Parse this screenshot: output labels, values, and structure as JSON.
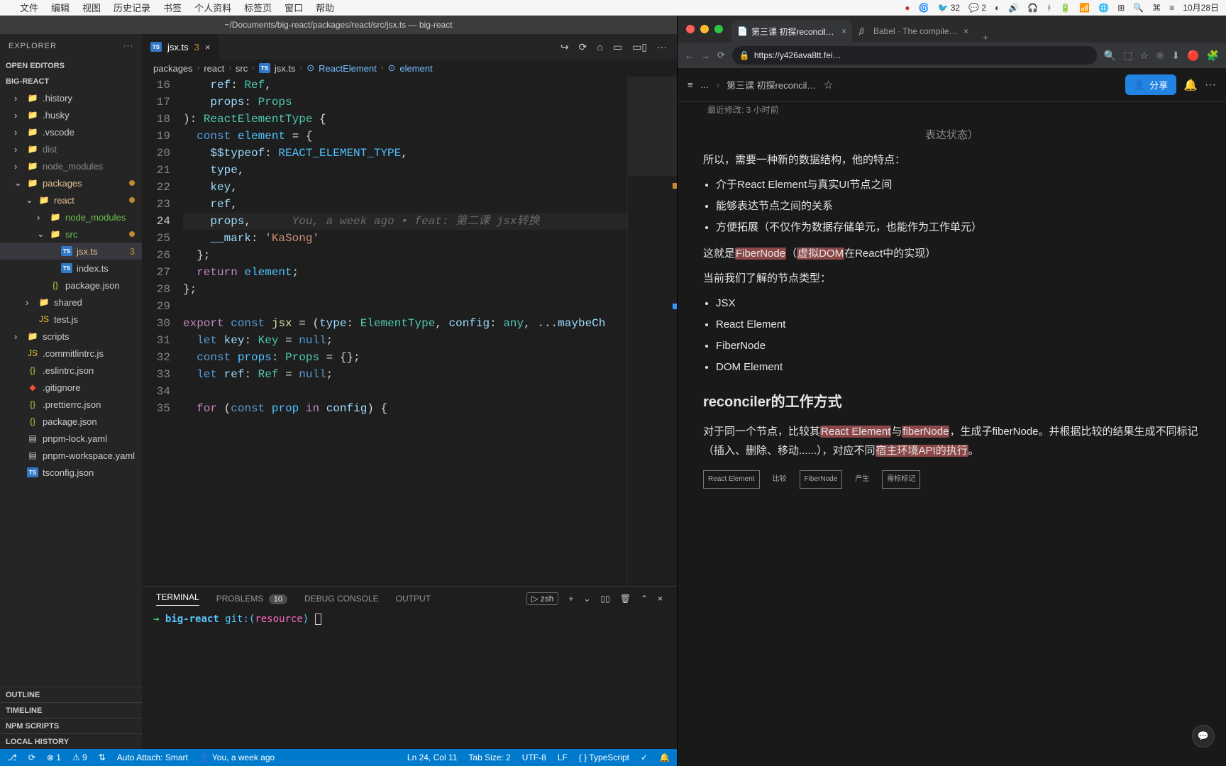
{
  "menubar": {
    "apple": "",
    "items": [
      "文件",
      "编辑",
      "视图",
      "历史记录",
      "书签",
      "个人资料",
      "标签页",
      "窗口",
      "帮助"
    ],
    "right": {
      "rec": "●",
      "cpu": "🌀",
      "bird": "🐦 32",
      "wechat": "💬 2",
      "moon": "◐",
      "vol": "🔊",
      "head": "🎧",
      "bt": "ᚼ",
      "battery": "🔋",
      "wifi": "📶",
      "globe": "🌐",
      "grid": "⊞",
      "search": "🔍",
      "ctrl": "⌘",
      "tray": "≡",
      "clock": "10月28日"
    }
  },
  "vscode": {
    "title": "~/Documents/big-react/packages/react/src/jsx.ts — big-react",
    "explorer": {
      "label": "EXPLORER",
      "dots": "···",
      "sections": {
        "openEditors": "OPEN EDITORS",
        "project": "BIG-REACT"
      },
      "tree": [
        {
          "type": "folder",
          "name": ".history",
          "depth": 1
        },
        {
          "type": "folder",
          "name": ".husky",
          "depth": 1
        },
        {
          "type": "folder",
          "name": ".vscode",
          "depth": 1
        },
        {
          "type": "folder",
          "name": "dist",
          "depth": 1,
          "muted": true
        },
        {
          "type": "folder",
          "name": "node_modules",
          "depth": 1,
          "muted": true
        },
        {
          "type": "folder",
          "name": "packages",
          "depth": 1,
          "open": true,
          "color": "#e2c08d",
          "dot": true
        },
        {
          "type": "folder",
          "name": "react",
          "depth": 2,
          "open": true,
          "color": "#e2c08d",
          "dot": true
        },
        {
          "type": "folder",
          "name": "node_modules",
          "depth": 3,
          "green": true
        },
        {
          "type": "folder",
          "name": "src",
          "depth": 3,
          "open": true,
          "green": true,
          "dot": true
        },
        {
          "type": "file",
          "name": "jsx.ts",
          "depth": 4,
          "icon": "ts",
          "selected": true,
          "badge": "3",
          "color": "#e2c08d"
        },
        {
          "type": "file",
          "name": "index.ts",
          "depth": 4,
          "icon": "ts"
        },
        {
          "type": "file",
          "name": "package.json",
          "depth": 3,
          "icon": "json"
        },
        {
          "type": "folder",
          "name": "shared",
          "depth": 2
        },
        {
          "type": "file",
          "name": "test.js",
          "depth": 2,
          "icon": "js"
        },
        {
          "type": "folder",
          "name": "scripts",
          "depth": 1
        },
        {
          "type": "file",
          "name": ".commitlintrc.js",
          "depth": 1,
          "icon": "js"
        },
        {
          "type": "file",
          "name": ".eslintrc.json",
          "depth": 1,
          "icon": "json"
        },
        {
          "type": "file",
          "name": ".gitignore",
          "depth": 1,
          "icon": "git"
        },
        {
          "type": "file",
          "name": ".prettierrc.json",
          "depth": 1,
          "icon": "json"
        },
        {
          "type": "file",
          "name": "package.json",
          "depth": 1,
          "icon": "json"
        },
        {
          "type": "file",
          "name": "pnpm-lock.yaml",
          "depth": 1,
          "icon": "yaml"
        },
        {
          "type": "file",
          "name": "pnpm-workspace.yaml",
          "depth": 1,
          "icon": "yaml"
        },
        {
          "type": "file",
          "name": "tsconfig.json",
          "depth": 1,
          "icon": "ts"
        }
      ],
      "bottom": [
        "OUTLINE",
        "TIMELINE",
        "NPM SCRIPTS",
        "LOCAL HISTORY"
      ]
    },
    "tab": {
      "icon": "TS",
      "name": "jsx.ts",
      "num": "3",
      "close": "×"
    },
    "editorActions": [
      "↪",
      "⟳",
      "⌂",
      "▭",
      "▭▯",
      "···"
    ],
    "breadcrumbs": [
      "packages",
      "react",
      "src",
      "jsx.ts",
      "ReactElement",
      "element"
    ],
    "lines": [
      {
        "n": 16,
        "html": "    <span class='k-ident'>ref</span><span class='k-punct'>: </span><span class='k-type'>Ref</span><span class='k-punct'>,</span>"
      },
      {
        "n": 17,
        "html": "    <span class='k-ident'>props</span><span class='k-punct'>: </span><span class='k-type'>Props</span>"
      },
      {
        "n": 18,
        "html": "<span class='k-punct'>): </span><span class='k-type'>ReactElementType</span><span class='k-punct'> {</span>"
      },
      {
        "n": 19,
        "html": "  <span class='k-blue'>const</span> <span class='k-const'>element</span> <span class='k-punct'>= {</span>"
      },
      {
        "n": 20,
        "html": "    <span class='k-ident'>$$typeof</span><span class='k-punct'>: </span><span class='k-const'>REACT_ELEMENT_TYPE</span><span class='k-punct'>,</span>"
      },
      {
        "n": 21,
        "html": "    <span class='k-ident'>type</span><span class='k-punct'>,</span>"
      },
      {
        "n": 22,
        "html": "    <span class='k-ident'>key</span><span class='k-punct'>,</span>"
      },
      {
        "n": 23,
        "html": "    <span class='k-ident'>ref</span><span class='k-punct'>,</span>"
      },
      {
        "n": 24,
        "cur": true,
        "html": "    <span class='k-ident'>props</span><span class='k-punct'>,</span>      <span class='codelens'>You, a week ago • feat: 第二课 jsx转换</span>"
      },
      {
        "n": 25,
        "html": "    <span class='k-ident'>__mark</span><span class='k-punct'>: </span><span class='k-str'>'KaSong'</span>"
      },
      {
        "n": 26,
        "html": "  <span class='k-punct'>};</span>"
      },
      {
        "n": 27,
        "html": "  <span class='k-kw'>return</span> <span class='k-const'>element</span><span class='k-punct'>;</span>"
      },
      {
        "n": 28,
        "html": "<span class='k-punct'>};</span>"
      },
      {
        "n": 29,
        "html": ""
      },
      {
        "n": 30,
        "html": "<span class='k-kw'>export</span> <span class='k-blue'>const</span> <span class='k-func'>jsx</span> <span class='k-punct'>= (</span><span class='k-ident'>type</span><span class='k-punct'>: </span><span class='k-type'>ElementType</span><span class='k-punct'>, </span><span class='k-ident'>config</span><span class='k-punct'>: </span><span class='k-type'>any</span><span class='k-punct'>, ...</span><span class='k-ident'>maybeCh</span>"
      },
      {
        "n": 31,
        "html": "  <span class='k-blue'>let</span> <span class='k-ident'>key</span><span class='k-punct'>: </span><span class='k-type'>Key</span> <span class='k-punct'>= </span><span class='k-blue'>null</span><span class='k-punct'>;</span>"
      },
      {
        "n": 32,
        "html": "  <span class='k-blue'>const</span> <span class='k-const'>props</span><span class='k-punct'>: </span><span class='k-type'>Props</span> <span class='k-punct'>= {};</span>"
      },
      {
        "n": 33,
        "html": "  <span class='k-blue'>let</span> <span class='k-ident'>ref</span><span class='k-punct'>: </span><span class='k-type'>Ref</span> <span class='k-punct'>= </span><span class='k-blue'>null</span><span class='k-punct'>;</span>"
      },
      {
        "n": 34,
        "html": ""
      },
      {
        "n": 35,
        "html": "  <span class='k-kw'>for</span> <span class='k-punct'>(</span><span class='k-blue'>const</span> <span class='k-const'>prop</span> <span class='k-kw'>in</span> <span class='k-ident'>config</span><span class='k-punct'>) {</span>"
      }
    ],
    "panel": {
      "tabs": {
        "terminal": "TERMINAL",
        "problems": "PROBLEMS",
        "problemsBadge": "10",
        "debug": "DEBUG CONSOLE",
        "output": "OUTPUT"
      },
      "right": {
        "shell": "zsh",
        "plus": "+",
        "chev": "⌄",
        "split": "▯▯",
        "trash": "🗑",
        "up": "⌃",
        "close": "×"
      },
      "prompt": {
        "arrow": "→",
        "repo": "big-react",
        "git": "git:(",
        "branch": "resource",
        "paren": ")"
      }
    },
    "status": {
      "remote": "⎇",
      "sync": "⟳",
      "errors": "⊗ 1",
      "warnings": "⚠ 9",
      "port": "⇅",
      "attach": "Auto Attach: Smart",
      "blame": "You, a week ago",
      "pos": "Ln 24, Col 11",
      "tab": "Tab Size: 2",
      "enc": "UTF-8",
      "eol": "LF",
      "lang": "TypeScript",
      "langIcon": "{ }",
      "bell": "🔔",
      "prettier": "✓"
    }
  },
  "browser": {
    "tabs": [
      {
        "fav": "📄",
        "title": "第三课 初探reconciler - 飞…",
        "active": true
      },
      {
        "fav": "𝛽",
        "title": "Babel · The compiler for …",
        "active": false
      }
    ],
    "toolbar": {
      "back": "←",
      "fwd": "→",
      "reload": "⟳",
      "lock": "🔒",
      "url": "https://y426ava8tt.fei…",
      "zoom": "🔍",
      "read": "⬚",
      "star": "☆",
      "ext": "⚛",
      "dl": "⬇",
      "prof": "🔴",
      "puzzle": "🧩"
    },
    "doc": {
      "menu": "≡",
      "bc0": "…",
      "bc1": "第三课 初探reconcil…",
      "fav": "☆",
      "share": "分享",
      "shareIcon": "👤",
      "bell": "🔔",
      "more": "···",
      "sub": "最近修改: 3 小时前",
      "trailing": "表达状态）",
      "p1": "所以，需要一种新的数据结构，他的特点：",
      "li1": "介于React Element与真实UI节点之间",
      "li2": "能够表达节点之间的关系",
      "li3": "方便拓展（不仅作为数据存储单元，也能作为工作单元）",
      "p2a": "这就是",
      "p2hl1": "FiberNode",
      "p2b": "（",
      "p2hl2": "虚拟DOM",
      "p2c": "在React中的实现）",
      "p3": "当前我们了解的节点类型：",
      "li4": "JSX",
      "li5": "React Element",
      "li6": "FiberNode",
      "li7": "DOM Element",
      "h2": "reconciler的工作方式",
      "p4a": "对于同一个节点，比较其",
      "p4hl1": "React Element",
      "p4b": "与",
      "p4hl2": "fiberNode",
      "p4c": "，生成子fiberNode。并根据比较的结果生成不同标记（插入、删除、移动......），对应不同",
      "p4hl3": "宿主环境API的执行",
      "p4d": "。",
      "diag": {
        "a": "React Element",
        "a1": "比较",
        "b": "FiberNode",
        "b1": "产生",
        "c": "需标标记"
      },
      "fab": "💬"
    }
  }
}
